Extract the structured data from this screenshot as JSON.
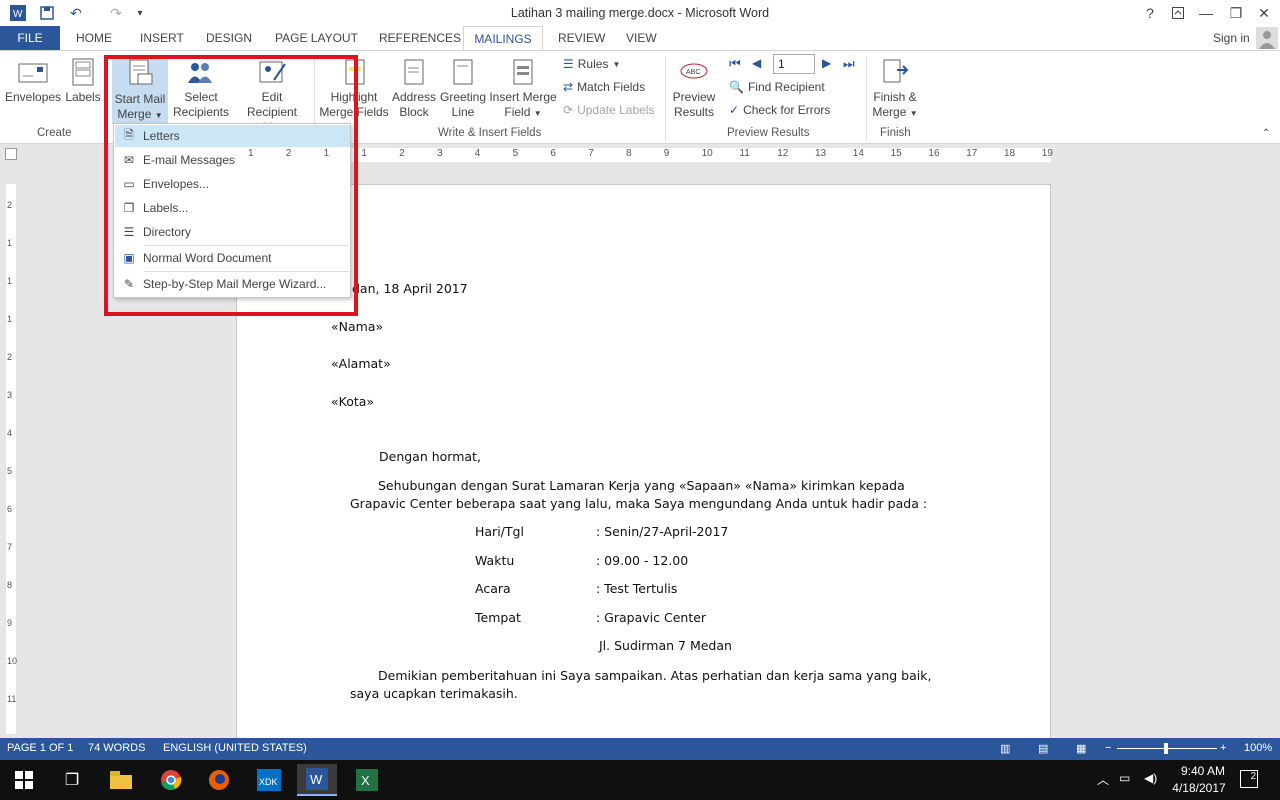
{
  "window": {
    "title": "Latihan 3 mailing merge.docx - Microsoft Word",
    "help": "?",
    "minimize": "—",
    "restore": "❐",
    "close": "✕"
  },
  "qat": {
    "undo": "↶",
    "redo": "↷",
    "customize": "▾"
  },
  "tabs": [
    "FILE",
    "HOME",
    "INSERT",
    "DESIGN",
    "PAGE LAYOUT",
    "REFERENCES",
    "MAILINGS",
    "REVIEW",
    "VIEW"
  ],
  "signin": "Sign in",
  "ribbon": {
    "create": {
      "envelopes": "Envelopes",
      "labels": "Labels",
      "group": "Create"
    },
    "start": {
      "start_mail": [
        "Start Mail",
        "Merge"
      ],
      "select": [
        "Select",
        "Recipients"
      ],
      "edit": [
        "Edit",
        "Recipient List"
      ]
    },
    "write": {
      "highlight": [
        "Highlight",
        "Merge Fields"
      ],
      "address": [
        "Address",
        "Block"
      ],
      "greeting": [
        "Greeting",
        "Line"
      ],
      "insert": [
        "Insert Merge",
        "Field"
      ],
      "rules": "Rules",
      "match": "Match Fields",
      "update": "Update Labels",
      "group": "Write & Insert Fields"
    },
    "preview": {
      "preview": [
        "Preview",
        "Results"
      ],
      "record": "1",
      "find": "Find Recipient",
      "check": "Check for Errors",
      "group": "Preview Results"
    },
    "finish": {
      "finish": [
        "Finish &",
        "Merge"
      ],
      "group": "Finish"
    }
  },
  "menu": {
    "items": [
      "Letters",
      "E-mail Messages",
      "Envelopes...",
      "Labels...",
      "Directory",
      "Normal Word Document",
      "Step-by-Step Mail Merge Wizard..."
    ]
  },
  "ruler_h": [
    "1",
    "2",
    "1",
    "1",
    "2",
    "3",
    "4",
    "5",
    "6",
    "7",
    "8",
    "9",
    "10",
    "11",
    "12",
    "13",
    "14",
    "15",
    "16",
    "17",
    "18",
    "19"
  ],
  "ruler_v": [
    "2",
    "1",
    "1",
    "1",
    "2",
    "3",
    "4",
    "5",
    "6",
    "7",
    "8",
    "9",
    "10",
    "11"
  ],
  "doc": {
    "date": "dan, 18 April 2017",
    "f1": "«Nama»",
    "f2": "«Alamat»",
    "f3": "«Kota»",
    "greet": "Dengan hormat,",
    "p1a": "Sehubungan dengan Surat Lamaran Kerja yang «Sapaan» «Nama» kirimkan kepada",
    "p1b": "Grapavic Center beberapa saat yang lalu, maka Saya mengundang Anda untuk hadir pada :",
    "rows": [
      [
        "Hari/Tgl",
        ": Senin/27-April-2017"
      ],
      [
        "Waktu",
        ": 09.00 - 12.00"
      ],
      [
        "Acara",
        ": Test Tertulis"
      ],
      [
        "Tempat",
        ": Grapavic Center"
      ]
    ],
    "addr": "Jl. Sudirman 7 Medan",
    "p2a": "Demikian pemberitahuan ini Saya sampaikan. Atas perhatian dan kerja sama yang baik,",
    "p2b": "saya ucapkan terimakasih."
  },
  "status": {
    "page": "PAGE 1 OF 1",
    "words": "74 WORDS",
    "lang": "ENGLISH (UNITED STATES)",
    "zoom": "100%",
    "zoom_minus": "−",
    "zoom_plus": "+"
  },
  "taskbar": {
    "time": "9:40 AM",
    "date": "4/18/2017",
    "notif": "2"
  }
}
